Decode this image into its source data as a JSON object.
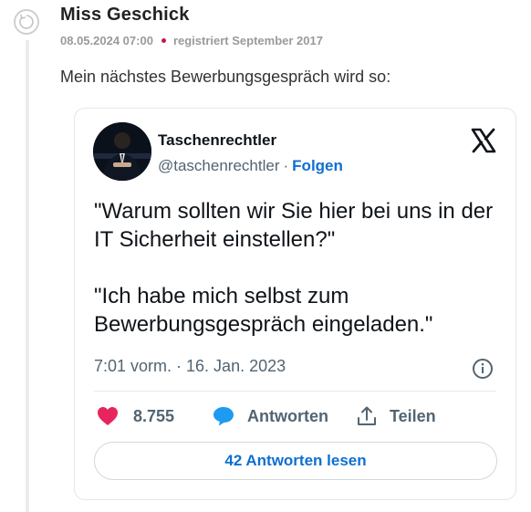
{
  "post": {
    "author": "Miss Geschick",
    "date": "08.05.2024 07:00",
    "registered": "registriert September 2017",
    "text": "Mein nächstes Bewerbungsgespräch wird so:"
  },
  "tweet": {
    "name": "Taschenrechtler",
    "handle": "@taschenrechtler",
    "separator": "·",
    "follow_label": "Folgen",
    "body": [
      "\"Warum sollten wir Sie hier bei uns in der IT Sicherheit einstellen?\"",
      "\"Ich habe mich selbst zum Bewerbungsgespräch eingeladen.\""
    ],
    "timestamp": "7:01 vorm. · 16. Jan. 2023",
    "likes": "8.755",
    "reply_label": "Antworten",
    "share_label": "Teilen",
    "read_replies_label": "42 Antworten lesen"
  },
  "colors": {
    "accent_blue": "#0f6fd1",
    "like_pink": "#e8245e",
    "reply_blue": "#1d9bf0",
    "meta_dot": "#c0185c"
  }
}
